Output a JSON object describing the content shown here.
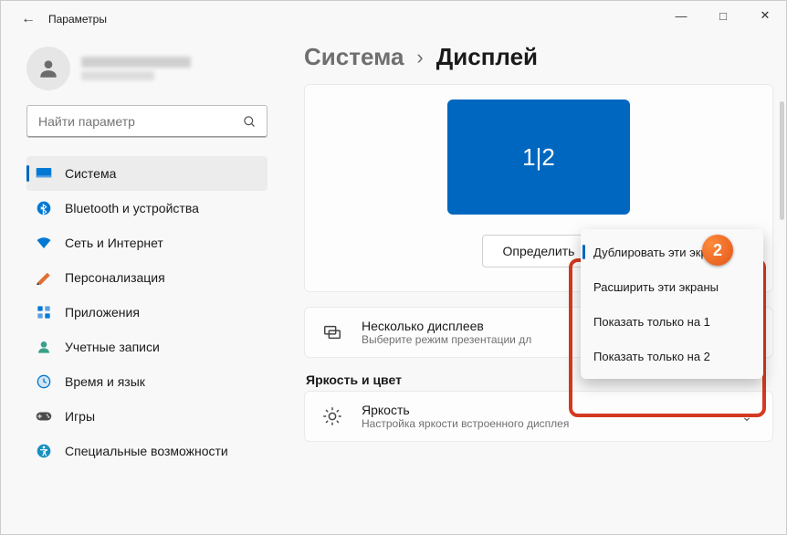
{
  "window": {
    "title": "Параметры",
    "back": "←",
    "min": "—",
    "max": "□",
    "close": "✕"
  },
  "search": {
    "placeholder": "Найти параметр"
  },
  "sidebar": [
    {
      "icon": "system",
      "label": "Система",
      "active": true
    },
    {
      "icon": "bluetooth",
      "label": "Bluetooth и устройства"
    },
    {
      "icon": "network",
      "label": "Сеть и Интернет"
    },
    {
      "icon": "personalize",
      "label": "Персонализация"
    },
    {
      "icon": "apps",
      "label": "Приложения"
    },
    {
      "icon": "accounts",
      "label": "Учетные записи"
    },
    {
      "icon": "time",
      "label": "Время и язык"
    },
    {
      "icon": "gaming",
      "label": "Игры"
    },
    {
      "icon": "access",
      "label": "Специальные возможности"
    }
  ],
  "breadcrumb": {
    "parent": "Система",
    "current": "Дисплей",
    "sep": "›"
  },
  "display": {
    "rect_label": "1|2",
    "identify": "Определить"
  },
  "dropdown": [
    "Дублировать эти экраны",
    "Расширить эти экраны",
    "Показать только на 1",
    "Показать только на 2"
  ],
  "badge": "2",
  "multi": {
    "title": "Несколько дисплеев",
    "desc": "Выберите режим презентации дл"
  },
  "section": "Яркость и цвет",
  "bright": {
    "title": "Яркость",
    "desc": "Настройка яркости встроенного дисплея"
  }
}
